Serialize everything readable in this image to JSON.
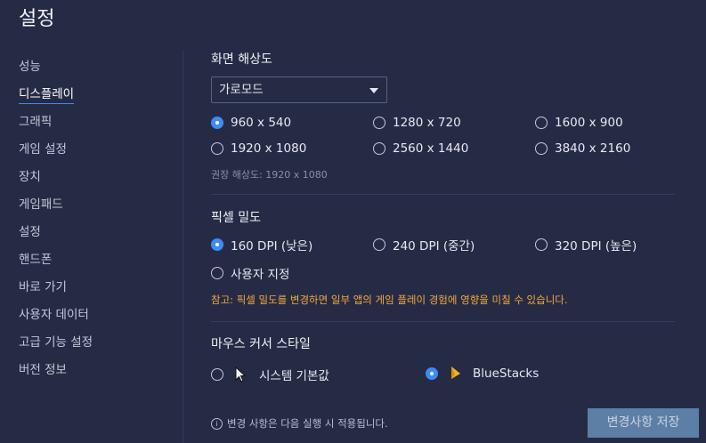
{
  "window": {
    "title": "설정"
  },
  "sidebar": {
    "items": [
      {
        "label": "성능"
      },
      {
        "label": "디스플레이",
        "active": true
      },
      {
        "label": "그래픽"
      },
      {
        "label": "게임 설정"
      },
      {
        "label": "장치"
      },
      {
        "label": "게임패드"
      },
      {
        "label": "설정"
      },
      {
        "label": "핸드폰"
      },
      {
        "label": "바로 가기"
      },
      {
        "label": "사용자 데이터"
      },
      {
        "label": "고급 기능 설정"
      },
      {
        "label": "버전 정보"
      }
    ]
  },
  "resolution": {
    "title": "화면 해상도",
    "orientation_selected": "가로모드",
    "options": [
      "960 x 540",
      "1280 x 720",
      "1600 x 900",
      "1920 x 1080",
      "2560 x 1440",
      "3840 x 2160"
    ],
    "selected": "960 x 540",
    "recommended": "권장 해상도: 1920 x 1080"
  },
  "density": {
    "title": "픽셀 밀도",
    "options": [
      "160 DPI (낮은)",
      "240 DPI (중간)",
      "320 DPI (높은)",
      "사용자 지정"
    ],
    "selected": "160 DPI (낮은)",
    "warning": "참고: 픽셀 밀도를 변경하면 일부 앱의 게임 플레이 경험에 영향을 미칠 수 있습니다."
  },
  "cursor": {
    "title": "마우스 커서 스타일",
    "options": [
      "시스템 기본값",
      "BlueStacks"
    ],
    "selected": "BlueStacks"
  },
  "footer": {
    "note": "변경 사항은 다음 실행 시 적용됩니다.",
    "save_label": "변경사항 저장"
  },
  "colors": {
    "accent": "#3d8cf5",
    "background": "#262b45",
    "warning": "#f2a93b",
    "save_button": "#5d7fa6"
  }
}
